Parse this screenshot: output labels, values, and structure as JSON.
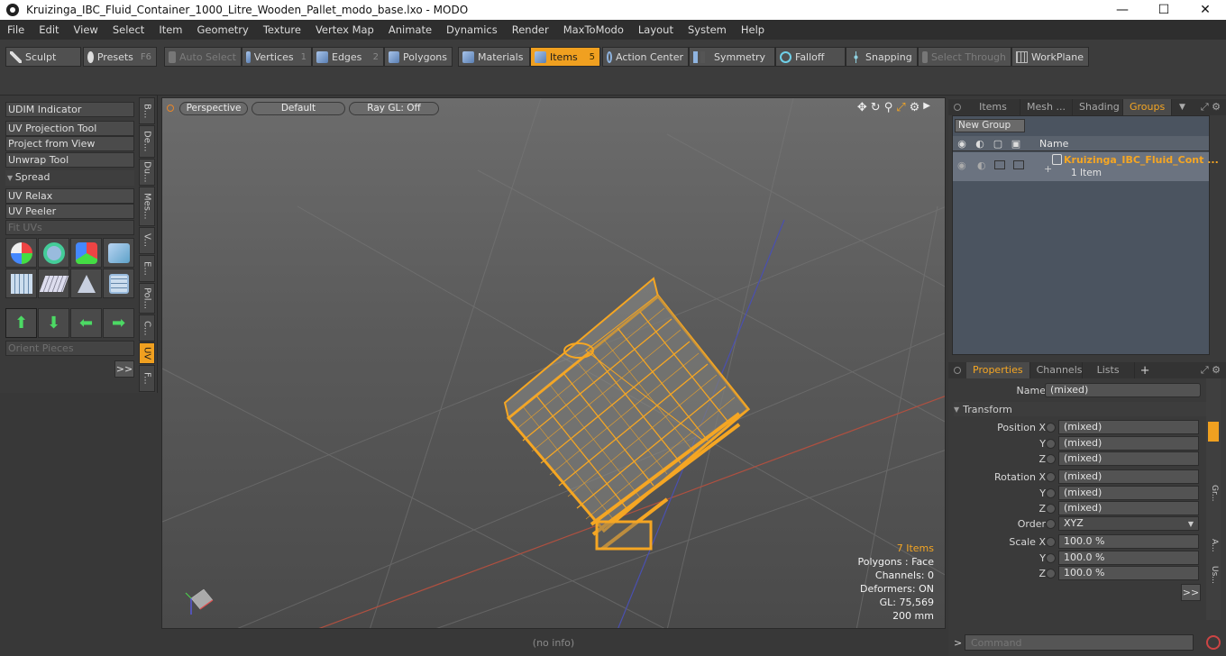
{
  "window": {
    "title": "Kruizinga_IBC_Fluid_Container_1000_Litre_Wooden_Pallet_modo_base.lxo - MODO",
    "minimize": "—",
    "maximize": "☐",
    "close": "✕"
  },
  "menu": [
    "File",
    "Edit",
    "View",
    "Select",
    "Item",
    "Geometry",
    "Texture",
    "Vertex Map",
    "Animate",
    "Dynamics",
    "Render",
    "MaxToModo",
    "Layout",
    "System",
    "Help"
  ],
  "toolbar": {
    "sculpt": "Sculpt",
    "presets": "Presets",
    "presets_key": "F6",
    "auto_select": "Auto Select",
    "vertices": "Vertices",
    "vertices_key": "1",
    "edges": "Edges",
    "edges_key": "2",
    "polygons": "Polygons",
    "materials": "Materials",
    "items": "Items",
    "items_key": "5",
    "action_center": "Action Center",
    "symmetry": "Symmetry",
    "falloff": "Falloff",
    "snapping": "Snapping",
    "select_through": "Select Through",
    "workplane": "WorkPlane"
  },
  "left_panel": {
    "udim": "UDIM Indicator",
    "uv_projection": "UV Projection Tool",
    "project_from_view": "Project from View",
    "unwrap": "Unwrap Tool",
    "spread": "Spread",
    "uv_relax": "UV Relax",
    "uv_peeler": "UV Peeler",
    "fit_uvs": "Fit UVs",
    "orient": "Orient Pieces",
    "more": ">>"
  },
  "vtabs": [
    "B...",
    "De...",
    "Du...",
    "Mes...",
    "V...",
    "E...",
    "Pol...",
    "C...",
    "UV",
    "F..."
  ],
  "viewport": {
    "perspective": "Perspective",
    "default": "Default",
    "raygl": "Ray GL: Off",
    "items_count": "7 Items",
    "polygons": "Polygons : Face",
    "channels": "Channels: 0",
    "deformers": "Deformers: ON",
    "gl": "GL: 75,569",
    "scale": "200 mm",
    "status": "(no info)"
  },
  "groups_panel": {
    "tabs": [
      "Items",
      "Mesh ...",
      "Shading",
      "Groups"
    ],
    "new_group": "New Group",
    "col_name": "Name",
    "row_name": "Kruizinga_IBC_Fluid_Cont ...",
    "row_sub": "1 Item"
  },
  "properties_panel": {
    "tabs": [
      "Properties",
      "Channels",
      "Lists"
    ],
    "add": "+",
    "name_label": "Name",
    "name_value": "(mixed)",
    "transform": "Transform",
    "position_x": "Position X",
    "rotation_x": "Rotation X",
    "scale_x": "Scale X",
    "y": "Y",
    "z": "Z",
    "mixed": "(mixed)",
    "order_label": "Order",
    "order_value": "XYZ",
    "scale_value": "100.0 %",
    "more": ">>",
    "side_tabs": [
      "Gr...",
      "A...",
      "Us..."
    ]
  },
  "command": {
    "prompt": ">",
    "placeholder": "Command"
  },
  "colors": {
    "accent": "#f0a020",
    "selection": "#f5a623"
  }
}
